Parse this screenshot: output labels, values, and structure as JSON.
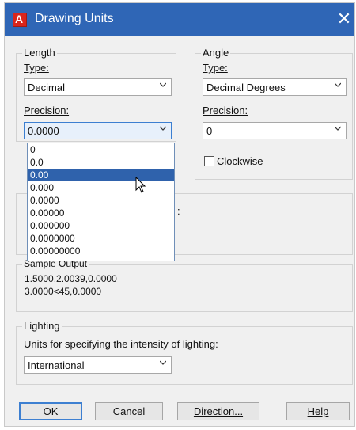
{
  "window": {
    "title": "Drawing Units",
    "close_glyph": "✕"
  },
  "length": {
    "group_label": "Length",
    "type_label": "Type:",
    "type_value": "Decimal",
    "precision_label": "Precision:",
    "precision_value": "0.0000",
    "precision_options": [
      "0",
      "0.0",
      "0.00",
      "0.000",
      "0.0000",
      "0.00000",
      "0.000000",
      "0.0000000",
      "0.00000000"
    ],
    "highlighted_option": "0.00"
  },
  "angle": {
    "group_label": "Angle",
    "type_label": "Type:",
    "type_value": "Decimal Degrees",
    "precision_label": "Precision:",
    "precision_value": "0",
    "clockwise_label": "Clockwise",
    "clockwise_checked": false
  },
  "insertion_partial_text": ":",
  "sample": {
    "group_label": "Sample Output",
    "line1": "1.5000,2.0039,0.0000",
    "line2": "3.0000<45,0.0000"
  },
  "lighting": {
    "group_label": "Lighting",
    "description": "Units for specifying the intensity of lighting:",
    "value": "International"
  },
  "buttons": {
    "ok": "OK",
    "cancel": "Cancel",
    "direction": "Direction...",
    "help": "Help"
  },
  "colors": {
    "titlebar": "#2f66b6",
    "selection": "#2f62ac",
    "dialog_bg": "#f0f0f0"
  }
}
